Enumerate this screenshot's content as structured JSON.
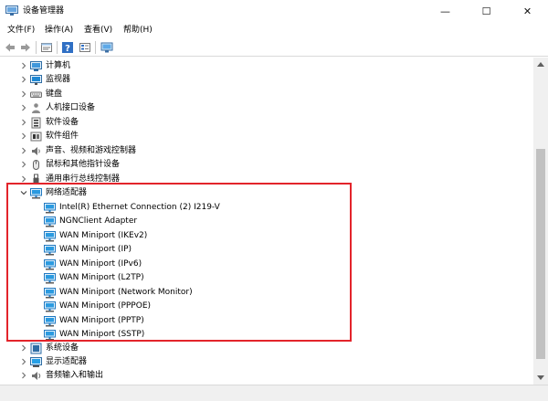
{
  "window": {
    "title": "设备管理器",
    "controls": {
      "minimize": "—",
      "maximize": "☐",
      "close": "✕"
    }
  },
  "menu": [
    {
      "label": "文件(F)"
    },
    {
      "label": "操作(A)"
    },
    {
      "label": "查看(V)"
    },
    {
      "label": "帮助(H)"
    }
  ],
  "toolbar": {
    "buttons": [
      "back-arrow-icon",
      "forward-arrow-icon",
      "properties-icon",
      "help-icon",
      "view-icon",
      "monitor-scan-icon"
    ]
  },
  "tree": {
    "categories_above": [
      {
        "label": "计算机",
        "icon": "computer-icon"
      },
      {
        "label": "监视器",
        "icon": "monitor-icon"
      },
      {
        "label": "键盘",
        "icon": "keyboard-icon"
      },
      {
        "label": "人机接口设备",
        "icon": "hid-icon"
      },
      {
        "label": "软件设备",
        "icon": "software-device-icon"
      },
      {
        "label": "软件组件",
        "icon": "software-component-icon"
      },
      {
        "label": "声音、视频和游戏控制器",
        "icon": "speaker-icon"
      },
      {
        "label": "鼠标和其他指针设备",
        "icon": "mouse-icon"
      },
      {
        "label": "通用串行总线控制器",
        "icon": "usb-icon"
      }
    ],
    "network": {
      "label": "网络适配器",
      "icon": "network-adapter-icon",
      "children": [
        "Intel(R) Ethernet Connection (2) I219-V",
        "NGNClient Adapter",
        "WAN Miniport (IKEv2)",
        "WAN Miniport (IP)",
        "WAN Miniport (IPv6)",
        "WAN Miniport (L2TP)",
        "WAN Miniport (Network Monitor)",
        "WAN Miniport (PPPOE)",
        "WAN Miniport (PPTP)",
        "WAN Miniport (SSTP)"
      ]
    },
    "categories_below": [
      {
        "label": "系统设备",
        "icon": "system-device-icon"
      },
      {
        "label": "显示适配器",
        "icon": "display-adapter-icon"
      },
      {
        "label": "音频输入和输出",
        "icon": "audio-icon"
      }
    ]
  },
  "colors": {
    "highlight": "#e3242b",
    "net_icon": "#1f8fd6",
    "selection": "#cce8ff"
  }
}
